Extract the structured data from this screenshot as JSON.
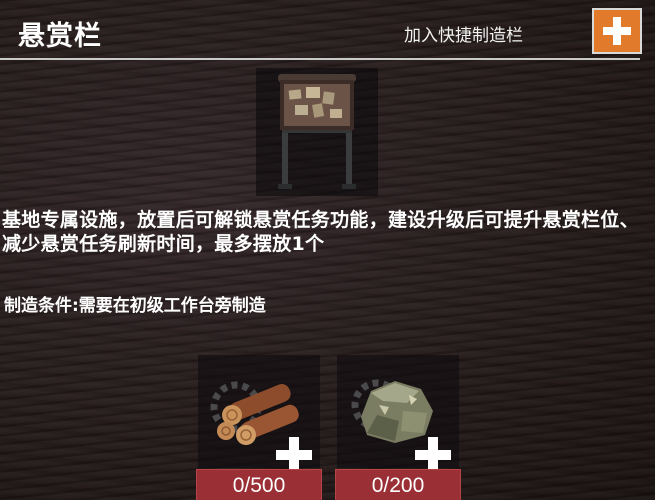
{
  "header": {
    "title": "悬赏栏",
    "quick_craft_label": "加入快捷制造栏",
    "add_icon": "plus-icon",
    "accent_color": "#e27a2c"
  },
  "item": {
    "image_icon": "bounty-board-icon",
    "description": "基地专属设施，放置后可解锁悬赏任务功能，建设升级后可提升悬赏栏位、减少悬赏任务刷新时间，最多摆放1个",
    "condition": "制造条件:需要在初级工作台旁制造"
  },
  "materials": [
    {
      "icon": "wood-logs-icon",
      "count": "0/500"
    },
    {
      "icon": "stone-ore-icon",
      "count": "0/200"
    }
  ],
  "colors": {
    "count_background": "#9a2f36"
  }
}
